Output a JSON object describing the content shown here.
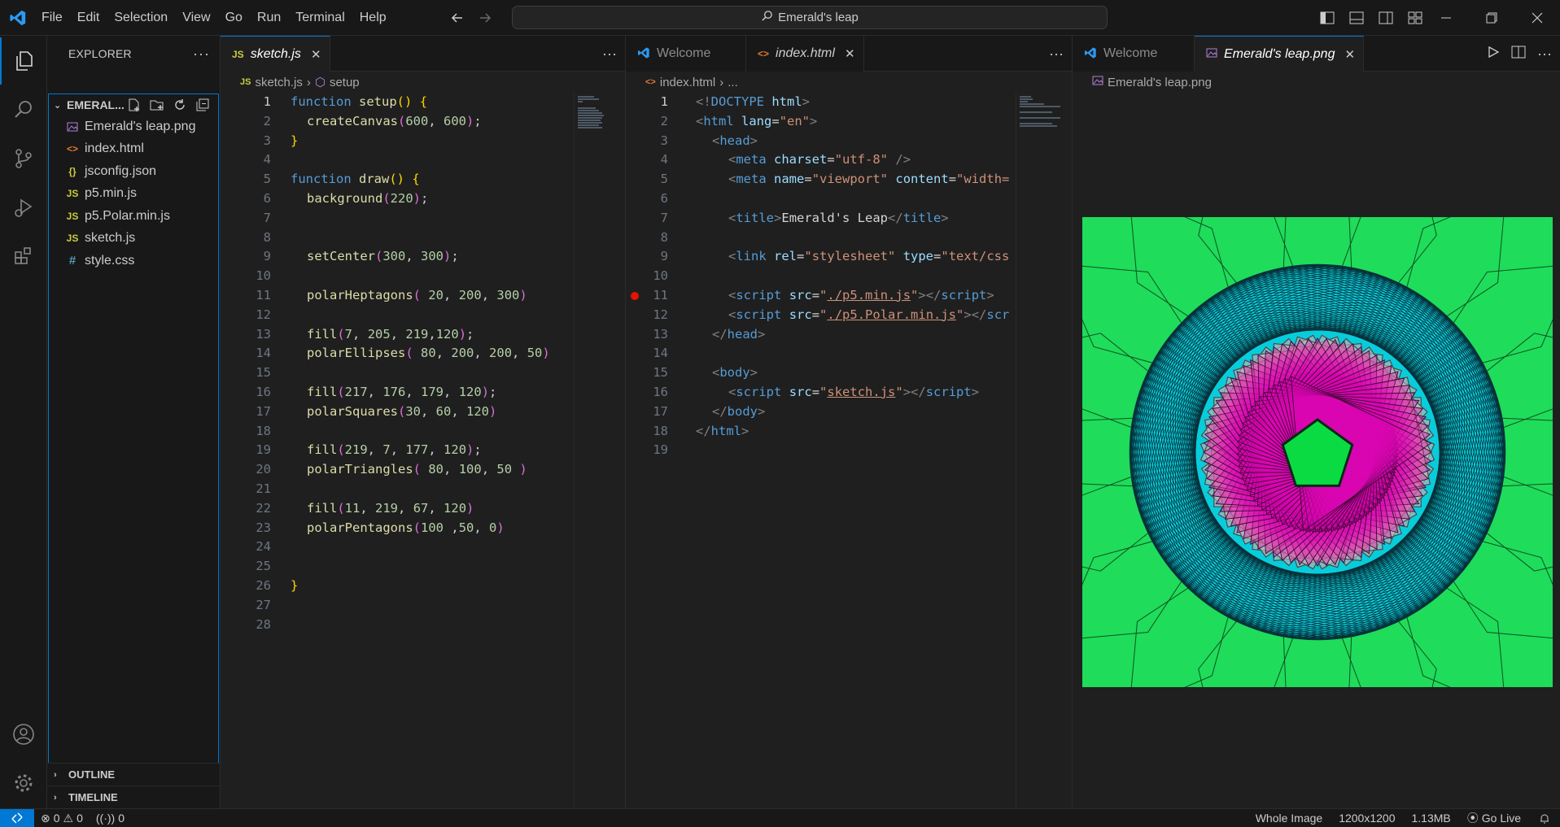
{
  "titlebar": {
    "menu": [
      "File",
      "Edit",
      "Selection",
      "View",
      "Go",
      "Run",
      "Terminal",
      "Help"
    ],
    "search": "Emerald's leap"
  },
  "sidebar": {
    "title": "EXPLORER",
    "folder": "EMERAL...",
    "files": [
      {
        "name": "Emerald's leap.png",
        "icon": "image-file-icon"
      },
      {
        "name": "index.html",
        "icon": "html-file-icon"
      },
      {
        "name": "jsconfig.json",
        "icon": "json-file-icon"
      },
      {
        "name": "p5.min.js",
        "icon": "js-file-icon"
      },
      {
        "name": "p5.Polar.min.js",
        "icon": "js-file-icon"
      },
      {
        "name": "sketch.js",
        "icon": "js-file-icon"
      },
      {
        "name": "style.css",
        "icon": "css-file-icon"
      }
    ],
    "outline": "OUTLINE",
    "timeline": "TIMELINE"
  },
  "group1": {
    "tab": "sketch.js",
    "breadcrumb": {
      "file": "sketch.js",
      "symbol": "setup"
    }
  },
  "group2": {
    "tabs": [
      "Welcome",
      "index.html"
    ],
    "breadcrumb": {
      "file": "index.html",
      "rest": "..."
    }
  },
  "group3": {
    "tabs": [
      "Welcome",
      "Emerald's leap.png"
    ],
    "breadcrumb": "Emerald's leap.png"
  },
  "statusbar": {
    "errors": "0",
    "warnings": "0",
    "ports": "0",
    "scope": "Whole Image",
    "dimensions": "1200x1200",
    "size": "1.13MB",
    "golive": "Go Live"
  },
  "colors": {
    "accent": "#0078d4",
    "breakpoint": "#e51400",
    "image_green": "#1fe05a",
    "image_cyan": "#07cddb",
    "image_pink": "#dbb0b3",
    "image_magenta": "#db07b1"
  }
}
